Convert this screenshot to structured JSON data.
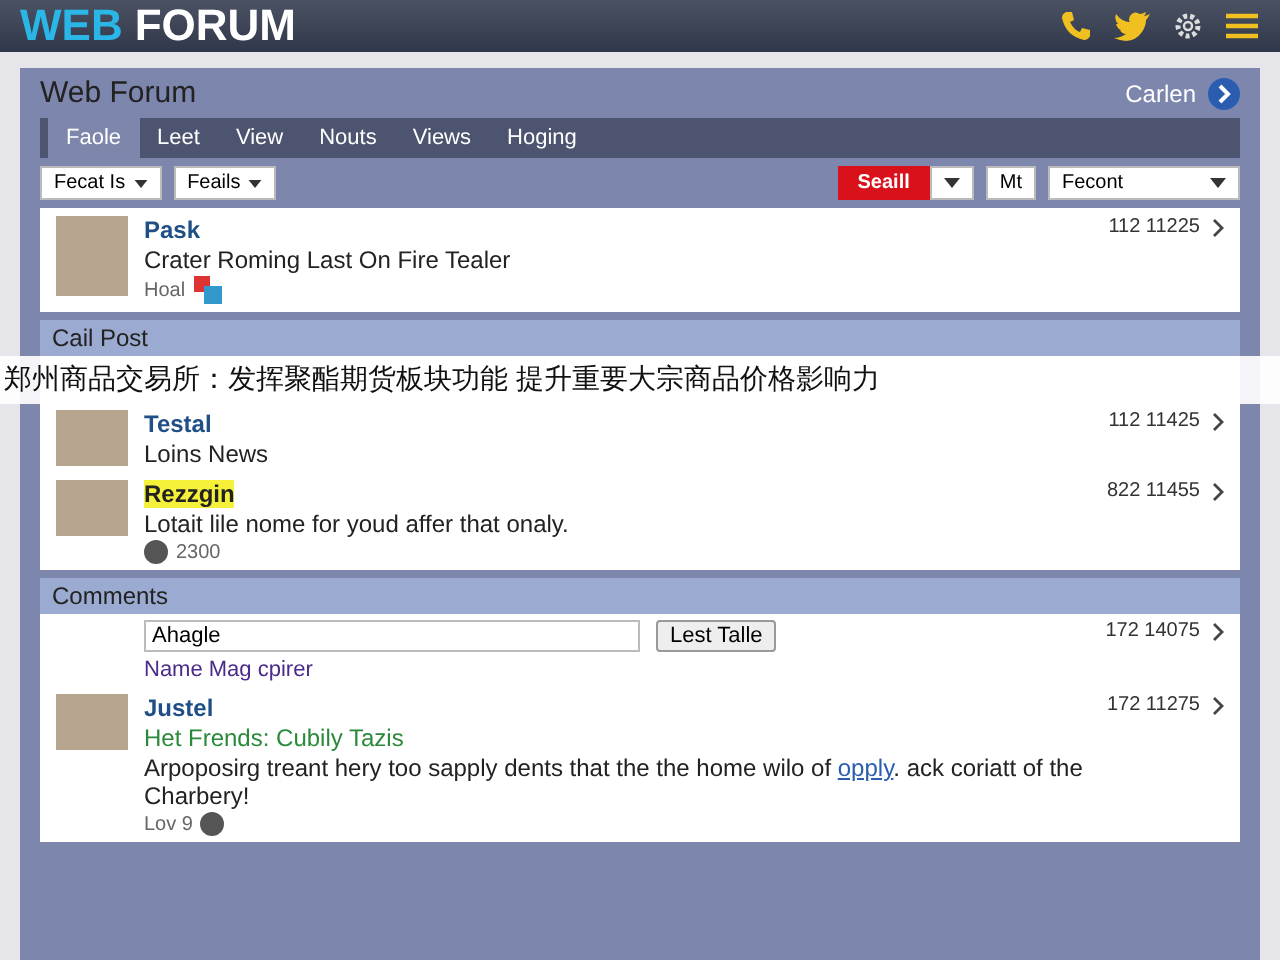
{
  "header": {
    "logo_first": "WEB",
    "logo_second": "FORUM"
  },
  "forum": {
    "title": "Web Forum",
    "user": "Carlen"
  },
  "tabs": [
    {
      "label": "Faole",
      "selected": true
    },
    {
      "label": "Leet",
      "selected": false
    },
    {
      "label": "View",
      "selected": false
    },
    {
      "label": "Nouts",
      "selected": false
    },
    {
      "label": "Views",
      "selected": false
    },
    {
      "label": "Hoging",
      "selected": false
    }
  ],
  "filters": [
    "Fecat Is",
    "Feails"
  ],
  "search_button": "Seaill",
  "filter_short": "Mt",
  "sort": "Fecont",
  "posts": [
    {
      "author": "Pask",
      "text": "Crater Roming Last On Fire Tealer",
      "meta": "Hoal",
      "stamp": "112 11225"
    }
  ],
  "call_post": {
    "title": "Cail Post",
    "items": [
      {
        "author": "Testal",
        "text": "Loins News",
        "stamp": "112 11425",
        "highlighted": false
      },
      {
        "author": "Rezzgin",
        "text": "Lotait lile nome for youd affer that onaly.",
        "meta": "2300",
        "stamp": "822 11455",
        "highlighted": true
      }
    ]
  },
  "banner": "郑州商品交易所：发挥聚酯期货板块功能 提升重要大宗商品价格影响力",
  "comments": {
    "title": "Comments",
    "input_value": "Ahagle",
    "button": "Lest Talle",
    "stamp": "172 14075",
    "link": "Name Mag cpirer",
    "items": [
      {
        "author": "Justel",
        "subject": "Het Frends: Cubily Tazis",
        "body": "Arpoposirg treant hery too sapply dents that the the home wilo of",
        "link": "opply",
        "body_tail": ". ack coriatt of the Charbery!",
        "meta": "Lov 9",
        "stamp": "172 11275"
      }
    ]
  }
}
